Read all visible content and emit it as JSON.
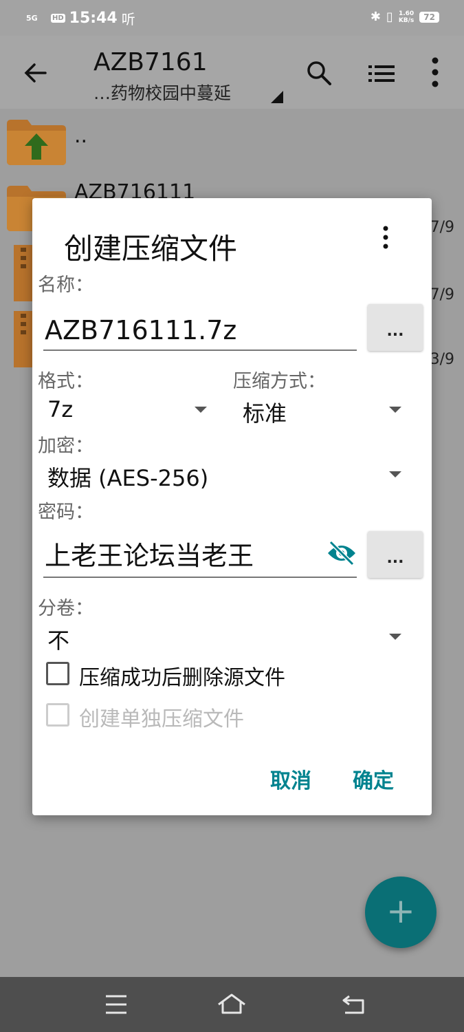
{
  "status_bar": {
    "signal": "5G",
    "hd": "HD",
    "time": "15:44",
    "extra": "听",
    "speed_value": "1.60",
    "speed_unit": "KB/s",
    "battery": "72"
  },
  "toolbar": {
    "title": "AZB7161",
    "subtitle": "…药物校园中蔓延"
  },
  "files": [
    {
      "name": "..",
      "date": ""
    },
    {
      "name": "AZB716111",
      "date": "7/9"
    },
    {
      "name": "",
      "date": "7/9"
    },
    {
      "name": "",
      "date": "3/9"
    }
  ],
  "dialog": {
    "title": "创建压缩文件",
    "name_label": "名称：",
    "name_value": "AZB716111.7z",
    "dots": "...",
    "format_label": "格式：",
    "format_value": "7z",
    "compression_label": "压缩方式：",
    "compression_value": "标准",
    "encryption_label": "加密：",
    "encryption_value": "数据 (AES-256)",
    "password_label": "密码：",
    "password_value": "上老王论坛当老王",
    "split_label": "分卷：",
    "split_value": "不",
    "delete_source_label": "压缩成功后删除源文件",
    "delete_source_checked": false,
    "separate_label": "创建单独压缩文件",
    "separate_checked": false,
    "cancel": "取消",
    "ok": "确定"
  },
  "fab": "+",
  "colors": {
    "accent": "#00838f",
    "fab": "#0a6f75",
    "folder": "#e0892e"
  },
  "icons": {
    "back": "arrow-left-icon",
    "search": "search-icon",
    "list": "list-view-icon",
    "more": "more-vert-icon",
    "eye": "eye-off-icon",
    "nav_menu": "menu-icon",
    "nav_home": "home-icon",
    "nav_back": "back-icon"
  }
}
